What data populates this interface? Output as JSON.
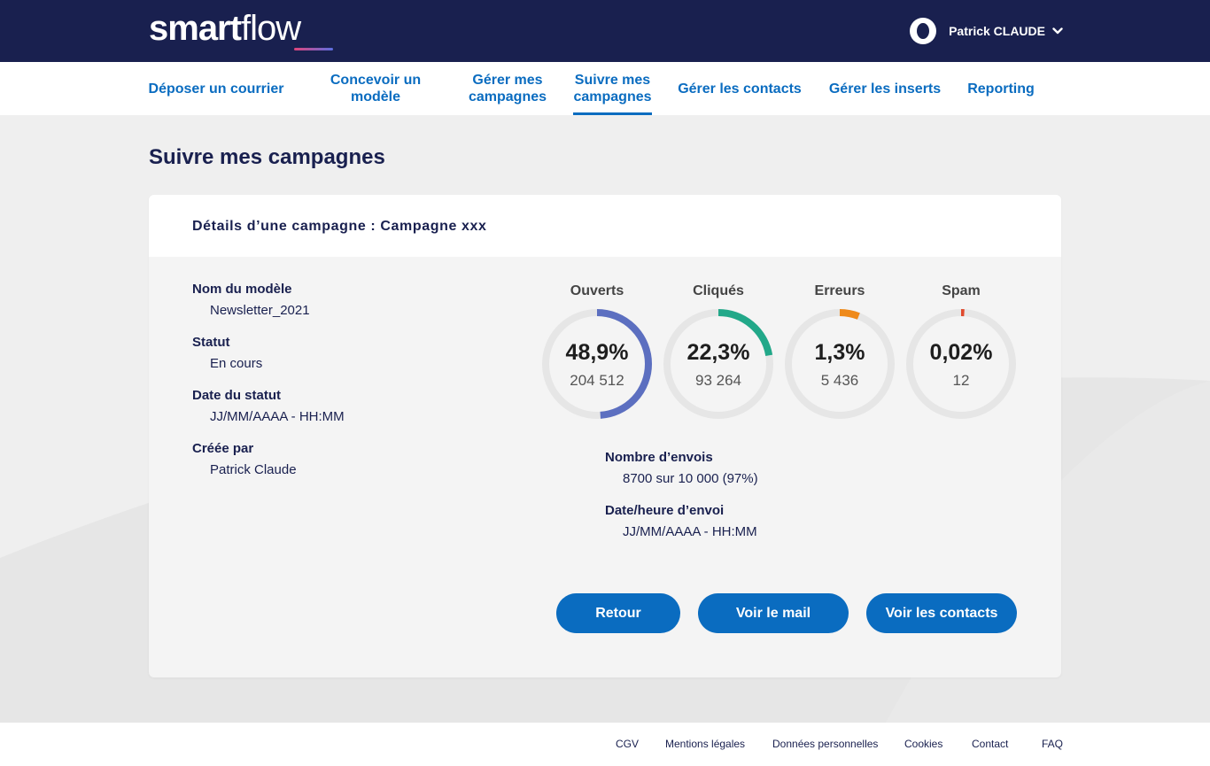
{
  "header": {
    "logo_bold": "smart",
    "logo_light": "flow",
    "user_name": "Patrick CLAUDE"
  },
  "nav": {
    "items": [
      {
        "label": "Déposer un courrier"
      },
      {
        "label": "Concevoir un modèle"
      },
      {
        "label": "Gérer mes campagnes"
      },
      {
        "label": "Suivre mes campagnes",
        "active": true
      },
      {
        "label": "Gérer les contacts"
      },
      {
        "label": "Gérer les inserts"
      },
      {
        "label": "Reporting"
      }
    ]
  },
  "page": {
    "title": "Suivre mes campagnes"
  },
  "card": {
    "title": "Détails d’une campagne : Campagne xxx",
    "fields": [
      {
        "label": "Nom du modèle",
        "value": "Newsletter_2021"
      },
      {
        "label": "Statut",
        "value": "En cours"
      },
      {
        "label": "Date du statut",
        "value": "JJ/MM/AAAA - HH:MM"
      },
      {
        "label": "Créée par",
        "value": "Patrick Claude"
      }
    ],
    "stats": [
      {
        "title": "Ouverts",
        "percent_text": "48,9%",
        "count": "204 512",
        "ratio": 0.489,
        "color": "#5c6fc0"
      },
      {
        "title": "Cliqués",
        "percent_text": "22,3%",
        "count": "93 264",
        "ratio": 0.223,
        "color": "#22a889"
      },
      {
        "title": "Erreurs",
        "percent_text": "1,3%",
        "count": "5 436",
        "ratio": 0.06,
        "color": "#ef8a1a"
      },
      {
        "title": "Spam",
        "percent_text": "0,02%",
        "count": "12",
        "ratio": 0.01,
        "color": "#e04a2e"
      }
    ],
    "sends": {
      "label": "Nombre d’envois",
      "value": "8700 sur 10 000 (97%)"
    },
    "send_date": {
      "label": "Date/heure d’envoi",
      "value": "JJ/MM/AAAA - HH:MM"
    },
    "buttons": {
      "back": "Retour",
      "view_mail": "Voir le mail",
      "view_contacts": "Voir les contacts"
    }
  },
  "footer": {
    "links": [
      "CGV",
      "Mentions légales",
      "Données personnelles",
      "Cookies",
      "Contact",
      "FAQ"
    ]
  },
  "colors": {
    "header_bg": "#19204f",
    "accent": "#0a6cc0",
    "ring_track": "#e6e6e6"
  }
}
